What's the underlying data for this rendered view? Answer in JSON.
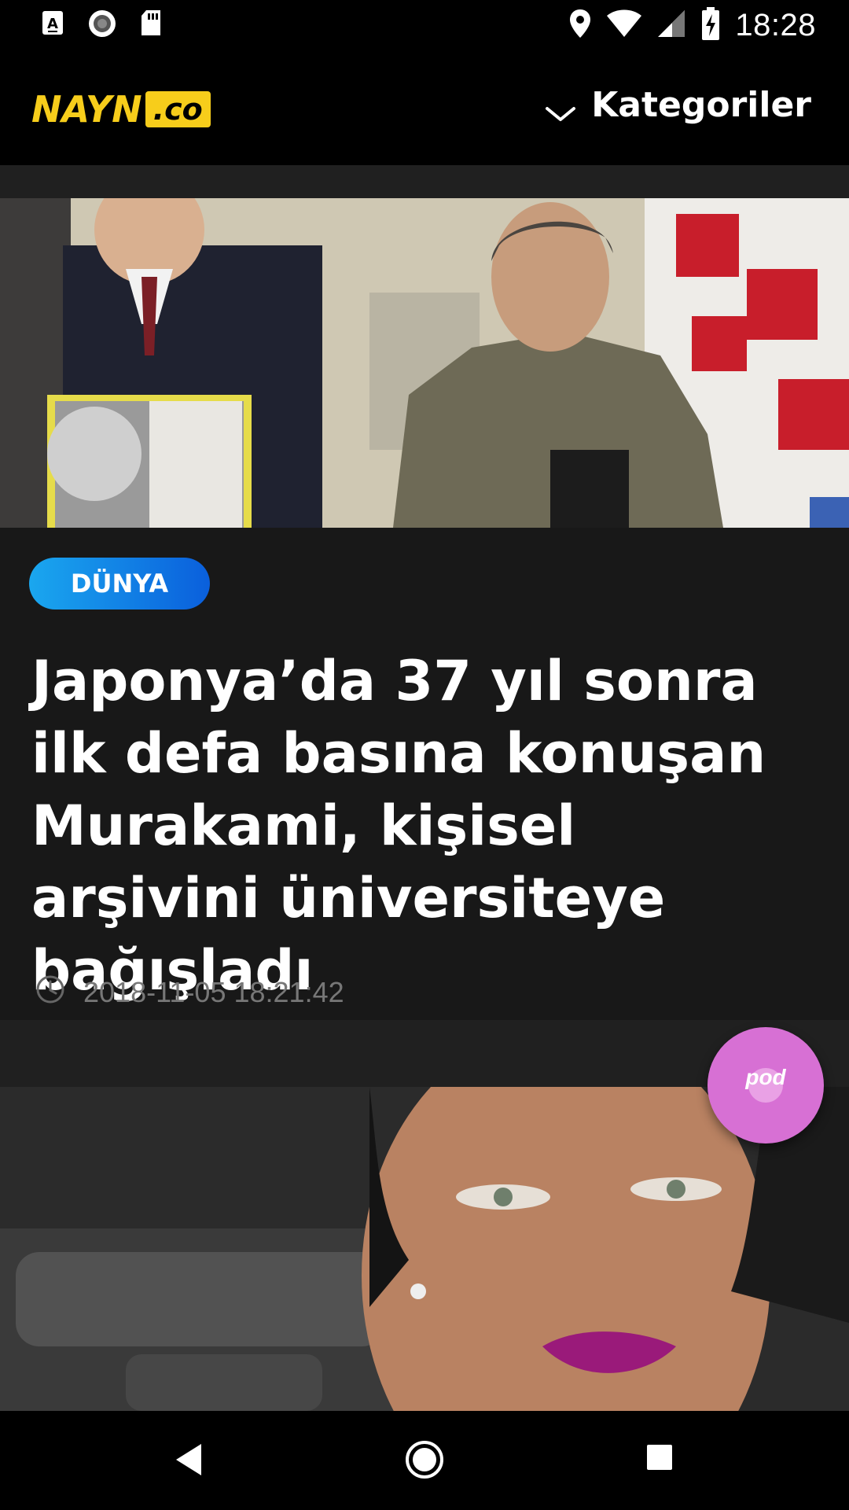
{
  "status_bar": {
    "time": "18:28",
    "icons": [
      "keyboard-a-icon",
      "sync-circle-icon",
      "sd-card-icon",
      "location-icon",
      "wifi-icon",
      "signal-icon",
      "battery-charging-icon"
    ]
  },
  "header": {
    "logo_text": "NAYN",
    "logo_suffix": ".co",
    "categories_label": "Kategoriler",
    "brand_color": "#f7cd1b"
  },
  "articles": [
    {
      "category": "DÜNYA",
      "title": "Japonya’da 37 yıl sonra ilk defa basına konuşan Murakami, kişisel arşivini üniversiteye bağışladı",
      "timestamp": "2018-11-05 18:21:42",
      "badge_color": "#1a8fe8"
    }
  ],
  "fab": {
    "label": "pod",
    "color": "#d770d4"
  },
  "nav_bar": {
    "icons": [
      "back-icon",
      "home-icon",
      "recents-icon"
    ]
  }
}
